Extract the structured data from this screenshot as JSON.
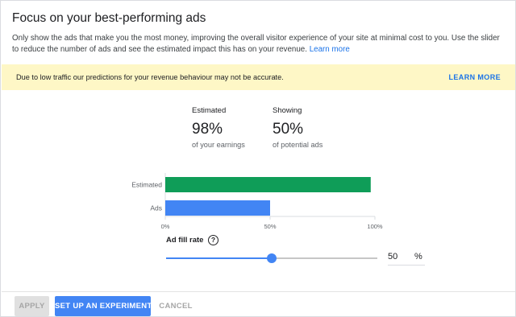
{
  "panel": {
    "title": "Focus on your best-performing ads",
    "description": "Only show the ads that make you the most money, improving the overall visitor experience of your site at minimal cost to you. Use the slider to reduce the number of ads and see the estimated impact this has on your revenue.",
    "description_link": "Learn more"
  },
  "warning": {
    "text": "Due to low traffic our predictions for your revenue behaviour may not be accurate.",
    "link": "LEARN MORE"
  },
  "stats": {
    "estimated": {
      "label": "Estimated",
      "value": "98%",
      "sub": "of your earnings"
    },
    "showing": {
      "label": "Showing",
      "value": "50%",
      "sub": "of potential ads"
    }
  },
  "chart_data": {
    "type": "bar",
    "orientation": "horizontal",
    "categories": [
      "Estimated",
      "Ads"
    ],
    "values": [
      98,
      50
    ],
    "colors": [
      "#0f9d58",
      "#4285f4"
    ],
    "xlim": [
      0,
      100
    ],
    "xticks": [
      "0%",
      "50%",
      "100%"
    ]
  },
  "slider": {
    "label": "Ad fill rate",
    "help_icon": "?",
    "value": 50,
    "value_text": "50",
    "unit": "%"
  },
  "buttons": {
    "apply": "APPLY",
    "experiment": "SET UP AN EXPERIMENT",
    "cancel": "CANCEL"
  },
  "colors": {
    "accent": "#4285f4",
    "estimated_bar": "#0f9d58",
    "warning_bg": "#fef7c6",
    "link": "#1a73e8"
  }
}
